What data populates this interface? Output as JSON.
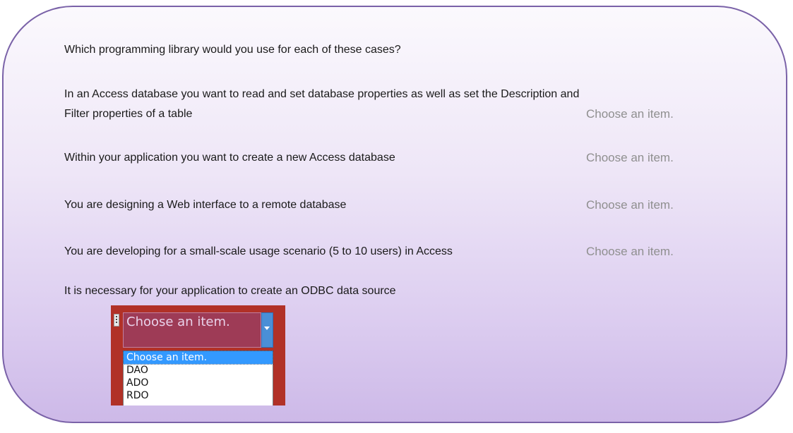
{
  "question": "Which programming library would you use for each of these cases?",
  "rows": [
    {
      "lines": [
        "In an Access database you want to read and set database properties as well as set the Description and",
        "Filter properties of a table"
      ],
      "choice": "Choose an item."
    },
    {
      "lines": [
        "Within your application you want to create a new Access database"
      ],
      "choice": "Choose an item."
    },
    {
      "lines": [
        "You are designing a Web interface to a remote database"
      ],
      "choice": "Choose an item."
    },
    {
      "lines": [
        "You are developing for a small-scale usage scenario (5 to 10 users) in Access"
      ],
      "choice": "Choose an item."
    },
    {
      "lines": [
        "It is necessary for your application to create an ODBC data source"
      ],
      "choice": ""
    }
  ],
  "dropdown": {
    "current_value": "Choose an item.",
    "options": [
      "Choose an item.",
      "DAO",
      "ADO",
      "RDO"
    ]
  },
  "colors": {
    "card_border": "#7a62a8",
    "choice_placeholder": "#8f8f8f",
    "dropdown_background": "#b13127",
    "selected_option": "#3399ff"
  }
}
